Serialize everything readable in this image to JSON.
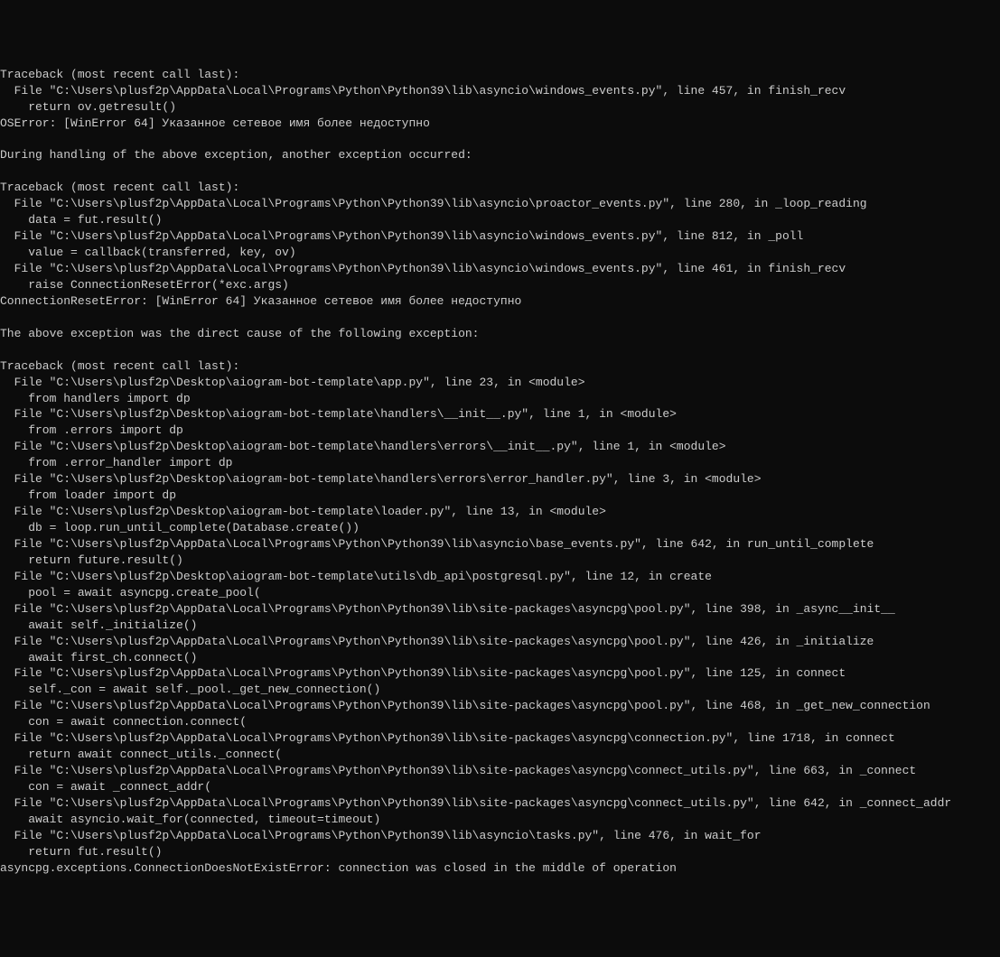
{
  "terminal": {
    "lines": [
      "Traceback (most recent call last):",
      "  File \"C:\\Users\\plusf2p\\AppData\\Local\\Programs\\Python\\Python39\\lib\\asyncio\\windows_events.py\", line 457, in finish_recv",
      "    return ov.getresult()",
      "OSError: [WinError 64] Указанное сетевое имя более недоступно",
      "",
      "During handling of the above exception, another exception occurred:",
      "",
      "Traceback (most recent call last):",
      "  File \"C:\\Users\\plusf2p\\AppData\\Local\\Programs\\Python\\Python39\\lib\\asyncio\\proactor_events.py\", line 280, in _loop_reading",
      "    data = fut.result()",
      "  File \"C:\\Users\\plusf2p\\AppData\\Local\\Programs\\Python\\Python39\\lib\\asyncio\\windows_events.py\", line 812, in _poll",
      "    value = callback(transferred, key, ov)",
      "  File \"C:\\Users\\plusf2p\\AppData\\Local\\Programs\\Python\\Python39\\lib\\asyncio\\windows_events.py\", line 461, in finish_recv",
      "    raise ConnectionResetError(*exc.args)",
      "ConnectionResetError: [WinError 64] Указанное сетевое имя более недоступно",
      "",
      "The above exception was the direct cause of the following exception:",
      "",
      "Traceback (most recent call last):",
      "  File \"C:\\Users\\plusf2p\\Desktop\\aiogram-bot-template\\app.py\", line 23, in <module>",
      "    from handlers import dp",
      "  File \"C:\\Users\\plusf2p\\Desktop\\aiogram-bot-template\\handlers\\__init__.py\", line 1, in <module>",
      "    from .errors import dp",
      "  File \"C:\\Users\\plusf2p\\Desktop\\aiogram-bot-template\\handlers\\errors\\__init__.py\", line 1, in <module>",
      "    from .error_handler import dp",
      "  File \"C:\\Users\\plusf2p\\Desktop\\aiogram-bot-template\\handlers\\errors\\error_handler.py\", line 3, in <module>",
      "    from loader import dp",
      "  File \"C:\\Users\\plusf2p\\Desktop\\aiogram-bot-template\\loader.py\", line 13, in <module>",
      "    db = loop.run_until_complete(Database.create())",
      "  File \"C:\\Users\\plusf2p\\AppData\\Local\\Programs\\Python\\Python39\\lib\\asyncio\\base_events.py\", line 642, in run_until_complete",
      "    return future.result()",
      "  File \"C:\\Users\\plusf2p\\Desktop\\aiogram-bot-template\\utils\\db_api\\postgresql.py\", line 12, in create",
      "    pool = await asyncpg.create_pool(",
      "  File \"C:\\Users\\plusf2p\\AppData\\Local\\Programs\\Python\\Python39\\lib\\site-packages\\asyncpg\\pool.py\", line 398, in _async__init__",
      "    await self._initialize()",
      "  File \"C:\\Users\\plusf2p\\AppData\\Local\\Programs\\Python\\Python39\\lib\\site-packages\\asyncpg\\pool.py\", line 426, in _initialize",
      "    await first_ch.connect()",
      "  File \"C:\\Users\\plusf2p\\AppData\\Local\\Programs\\Python\\Python39\\lib\\site-packages\\asyncpg\\pool.py\", line 125, in connect",
      "    self._con = await self._pool._get_new_connection()",
      "  File \"C:\\Users\\plusf2p\\AppData\\Local\\Programs\\Python\\Python39\\lib\\site-packages\\asyncpg\\pool.py\", line 468, in _get_new_connection",
      "    con = await connection.connect(",
      "  File \"C:\\Users\\plusf2p\\AppData\\Local\\Programs\\Python\\Python39\\lib\\site-packages\\asyncpg\\connection.py\", line 1718, in connect",
      "    return await connect_utils._connect(",
      "  File \"C:\\Users\\plusf2p\\AppData\\Local\\Programs\\Python\\Python39\\lib\\site-packages\\asyncpg\\connect_utils.py\", line 663, in _connect",
      "    con = await _connect_addr(",
      "  File \"C:\\Users\\plusf2p\\AppData\\Local\\Programs\\Python\\Python39\\lib\\site-packages\\asyncpg\\connect_utils.py\", line 642, in _connect_addr",
      "    await asyncio.wait_for(connected, timeout=timeout)",
      "  File \"C:\\Users\\plusf2p\\AppData\\Local\\Programs\\Python\\Python39\\lib\\asyncio\\tasks.py\", line 476, in wait_for",
      "    return fut.result()",
      "asyncpg.exceptions.ConnectionDoesNotExistError: connection was closed in the middle of operation"
    ]
  }
}
